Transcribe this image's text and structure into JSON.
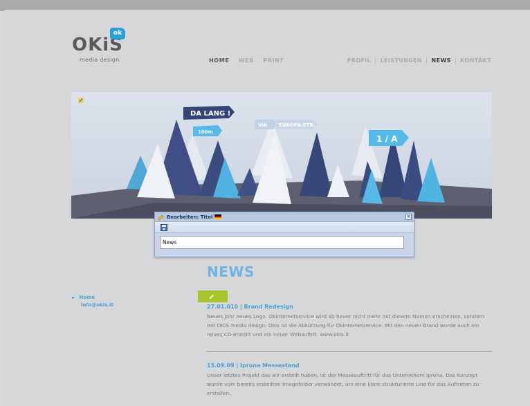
{
  "logo": {
    "word": "OKiS",
    "badge": "ok",
    "subtitle": "media design"
  },
  "nav_main": [
    {
      "label": "HOME",
      "active": true
    },
    {
      "label": "WEB",
      "active": false
    },
    {
      "label": "PRINT",
      "active": false
    }
  ],
  "nav_right": [
    {
      "label": "PROFIL",
      "active": false
    },
    {
      "label": "LEISTUNGEN",
      "active": false
    },
    {
      "label": "NEWS",
      "active": true
    },
    {
      "label": "KONTAKT",
      "active": false
    }
  ],
  "nav_separator": "|",
  "banner": {
    "signs": [
      "DA LANG !",
      "100m",
      "VIA",
      "EUROPA-STR.",
      "1 / A"
    ]
  },
  "dialog": {
    "title": "Bearbeiten: Titel",
    "close": "×",
    "input_value": "News"
  },
  "news_heading": "NEWS",
  "side_links": {
    "home": "Home",
    "email": "info@okis.it",
    "arrow": "►"
  },
  "articles": [
    {
      "title": "27.01.010 | Brand Redesign",
      "body": "Neues Jahr neues Logo. Okinternetservice wird ab heuer nicht mehr mit diesem Namen erscheinen, sondern mit OKiS media design. Okis ist die Abkürzung für Okinternetservice. Mit den neuen Brand wurde auch ein neues CD erstellt und ein neuer Webauftrit. www.okis.it"
    },
    {
      "title": "15.09.09 | Iprona Messestand",
      "body": "Unser letztes Projekt das wir erstellt haben, ist der Messeauftritt für das Unternehem Iprona. Das Konzept wurde vom bereits erstellten Imagefolder verwändet, um eine klare strukturierte Line für das Auftreten zu erstellen."
    }
  ],
  "colors": {
    "accent": "#4b9fd7",
    "heading": "#6fb3e0",
    "edit_chip": "#a8c52c"
  }
}
